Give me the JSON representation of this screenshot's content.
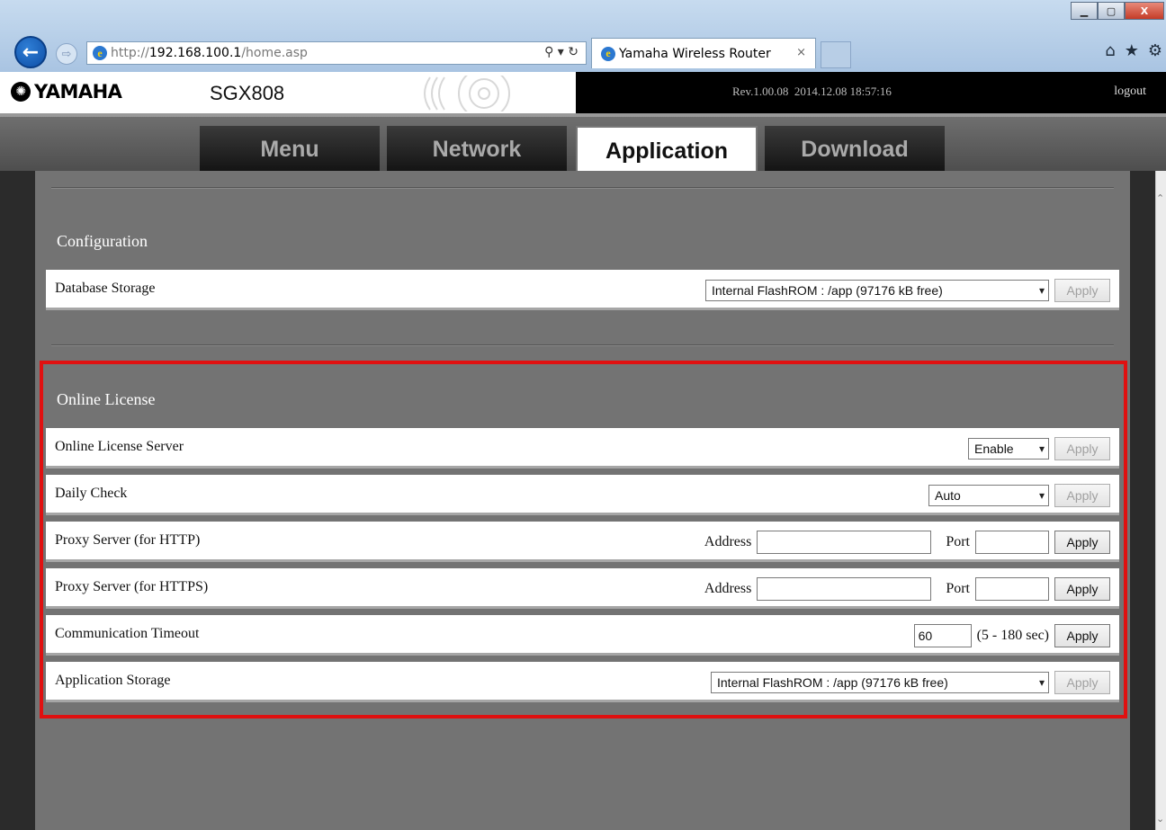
{
  "browser": {
    "back_glyph": "←",
    "forward_glyph": "⇨",
    "url_prefix": "http://",
    "url_host": "192.168.100.1",
    "url_path": "/home.asp",
    "address_tools": "⚲ ▾ ↻",
    "tab_title": "Yamaha Wireless Router",
    "tab_close": "×",
    "tools": [
      "⌂",
      "★",
      "⚙"
    ],
    "window_controls": [
      "▁",
      "▢",
      "X"
    ]
  },
  "header": {
    "logo_text": "YAMAHA",
    "model": "SGX808",
    "revision": "Rev.1.00.08",
    "build_date": "2014.12.08 18:57:16",
    "logout": "logout"
  },
  "nav": {
    "tabs": [
      "Menu",
      "Network",
      "Application",
      "Download"
    ],
    "active_tab": "Application"
  },
  "configuration": {
    "title": "Configuration",
    "rows": [
      {
        "label": "Database Storage",
        "select_value": "Internal FlashROM : /app (97176 kB free)",
        "apply": "Apply",
        "apply_enabled": false
      }
    ]
  },
  "online_license": {
    "title": "Online License",
    "server": {
      "label": "Online License Server",
      "select_value": "Enable",
      "apply": "Apply",
      "apply_enabled": false
    },
    "daily_check": {
      "label": "Daily Check",
      "select_value": "Auto",
      "apply": "Apply",
      "apply_enabled": false
    },
    "proxy_http": {
      "label": "Proxy Server (for HTTP)",
      "address_label": "Address",
      "address_value": "",
      "port_label": "Port",
      "port_value": "",
      "apply": "Apply",
      "apply_enabled": true
    },
    "proxy_https": {
      "label": "Proxy Server (for HTTPS)",
      "address_label": "Address",
      "address_value": "",
      "port_label": "Port",
      "port_value": "",
      "apply": "Apply",
      "apply_enabled": true
    },
    "timeout": {
      "label": "Communication Timeout",
      "value": "60",
      "range": "(5 - 180 sec)",
      "apply": "Apply",
      "apply_enabled": true
    },
    "app_storage": {
      "label": "Application Storage",
      "select_value": "Internal FlashROM : /app (97176 kB free)",
      "apply": "Apply",
      "apply_enabled": false
    }
  },
  "colors": {
    "highlight_border": "#e01010",
    "content_bg": "#737373",
    "header_dark": "#000000"
  }
}
